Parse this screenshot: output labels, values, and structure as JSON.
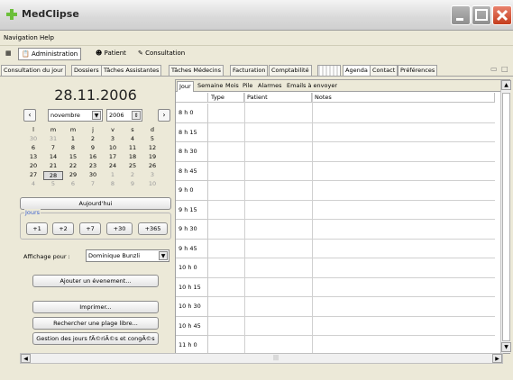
{
  "window": {
    "title": "MedClipse"
  },
  "menu": [
    "Navigation",
    "Help"
  ],
  "toolbar": {
    "items": [
      "Administration",
      "Patient",
      "Consultation"
    ]
  },
  "module_tabs": [
    "Consultation du jour",
    "Dossiers",
    "Tâches Assistantes",
    "Tâches Médecins",
    "Facturation",
    "Comptabilité",
    "Agenda",
    "Contact",
    "Préférences"
  ],
  "calendar": {
    "big_date": "28.11.2006",
    "month": "novembre",
    "year": "2006",
    "weekdays": [
      "l",
      "m",
      "m",
      "j",
      "v",
      "s",
      "d"
    ],
    "weeks": [
      [
        "30",
        "31",
        "1",
        "2",
        "3",
        "4",
        "5"
      ],
      [
        "6",
        "7",
        "8",
        "9",
        "10",
        "11",
        "12"
      ],
      [
        "13",
        "14",
        "15",
        "16",
        "17",
        "18",
        "19"
      ],
      [
        "20",
        "21",
        "22",
        "23",
        "24",
        "25",
        "26"
      ],
      [
        "27",
        "28",
        "29",
        "30",
        "1",
        "2",
        "3"
      ],
      [
        "4",
        "5",
        "6",
        "7",
        "8",
        "9",
        "10"
      ]
    ],
    "selected_day": "28",
    "today_button": "Aujourd'hui"
  },
  "jours": {
    "label": "Jours",
    "buttons": [
      "+1",
      "+2",
      "+7",
      "+30",
      "+365"
    ]
  },
  "affichage": {
    "label": "Affichage pour :",
    "value": "Dominique Bunzli"
  },
  "actions": {
    "add_event": "Ajouter un évenement...",
    "print": "Imprimer...",
    "find_slot": "Rechercher une plage libre...",
    "holidays": "Gestion des jours fÃ©riÃ©s et congÃ©s"
  },
  "agenda": {
    "tabs": [
      "Jour",
      "Semaine",
      "Mois",
      "Pile",
      "Alarmes",
      "Emails à envoyer"
    ],
    "columns": [
      "Type",
      "Patient",
      "Notes"
    ],
    "times": [
      "8 h 0",
      "8 h 15",
      "8 h 30",
      "8 h 45",
      "9 h 0",
      "9 h 15",
      "9 h 30",
      "9 h 45",
      "10 h 0",
      "10 h 15",
      "10 h 30",
      "10 h 45",
      "11 h 0"
    ]
  }
}
